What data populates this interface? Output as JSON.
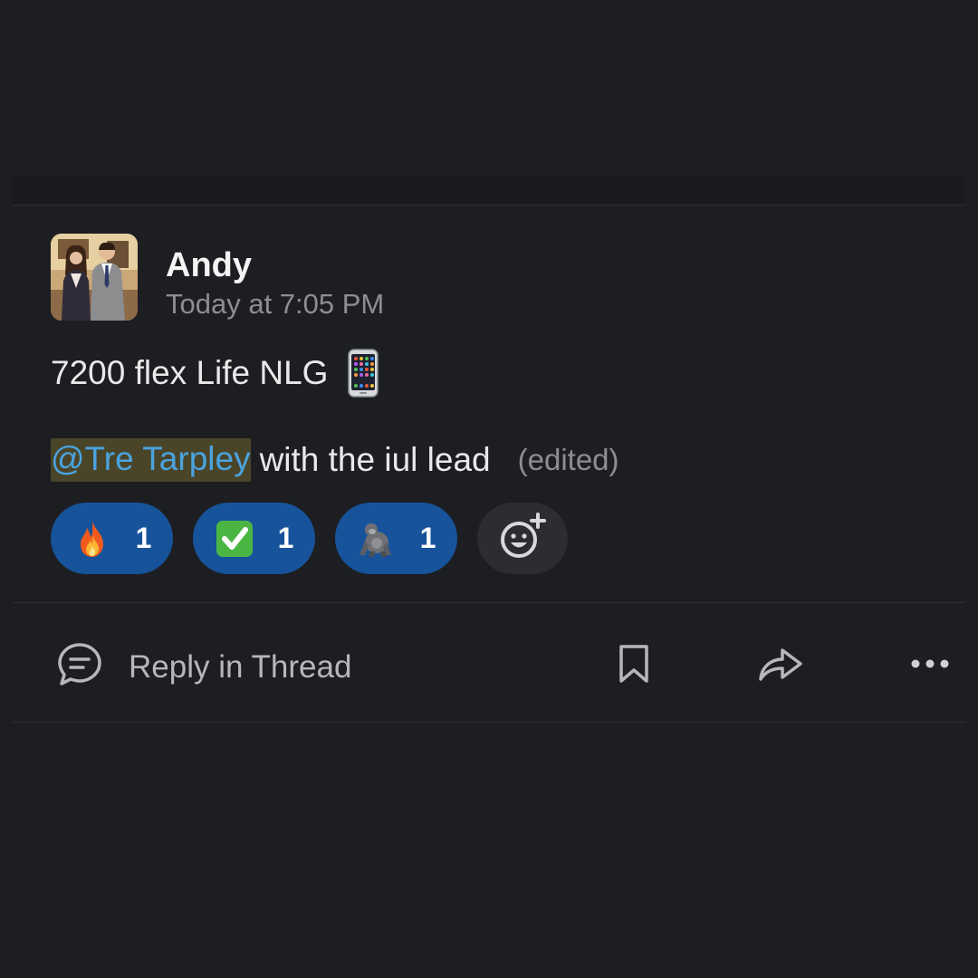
{
  "message": {
    "author": "Andy",
    "timestamp": "Today at 7:05 PM",
    "line1": "7200 flex Life NLG",
    "line1_emoji": "mobile-phone-icon",
    "mention": "@Tre Tarpley",
    "line2_rest": "with the iul lead",
    "edited_label": "(edited)"
  },
  "reactions": [
    {
      "emoji": "fire-icon",
      "count": "1"
    },
    {
      "emoji": "check-mark-icon",
      "count": "1"
    },
    {
      "emoji": "gorilla-icon",
      "count": "1"
    }
  ],
  "add_reaction_icon": "add-reaction-icon",
  "actions": {
    "reply_label": "Reply in Thread",
    "bookmark_icon": "bookmark-icon",
    "share_icon": "share-icon",
    "more_icon": "more-icon"
  },
  "colors": {
    "background": "#1d1e22",
    "reaction_bg": "#17539a",
    "mention_text": "#4aa3df",
    "mention_bg": "#4a4529",
    "muted_text": "#8d8e92"
  }
}
